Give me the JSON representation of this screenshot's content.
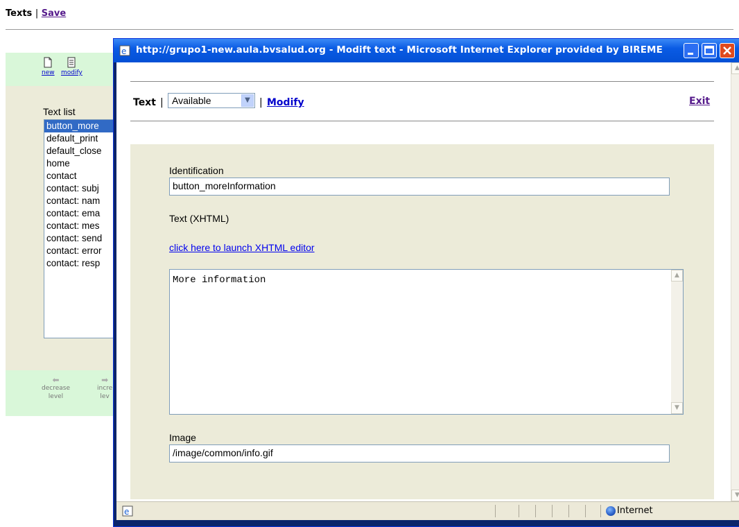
{
  "background": {
    "header": {
      "title": "Texts",
      "separator": "|",
      "save_link": "Save"
    },
    "toolbar": {
      "new_label": "new",
      "modify_label": "modify"
    },
    "text_list": {
      "label": "Text list",
      "items": [
        "button_more",
        "default_print",
        "default_close",
        "home",
        "contact",
        "contact: subj",
        "contact: nam",
        "contact: ema",
        "contact: mes",
        "contact: send",
        "contact: error",
        "contact: resp"
      ],
      "selected_index": 0
    },
    "level_bar": {
      "decrease_label_1": "decrease",
      "decrease_label_2": "level",
      "increase_label_1": "incre",
      "increase_label_2": "lev"
    }
  },
  "window": {
    "title": "http://grupo1-new.aula.bvsalud.org - Modift text - Microsoft Internet Explorer provided by BIREME",
    "header": {
      "text_label": "Text",
      "separator": "|",
      "status_value": "Available",
      "separator2": "|",
      "modify_link": "Modify",
      "exit_link": "Exit"
    },
    "form": {
      "identification_label": "Identification",
      "identification_value": "button_moreInformation",
      "text_label": "Text (XHTML)",
      "editor_link": "click here to launch XHTML editor",
      "text_value": "More information",
      "image_label": "Image",
      "image_value": "/image/common/info.gif"
    },
    "statusbar": {
      "zone": "Internet"
    }
  }
}
